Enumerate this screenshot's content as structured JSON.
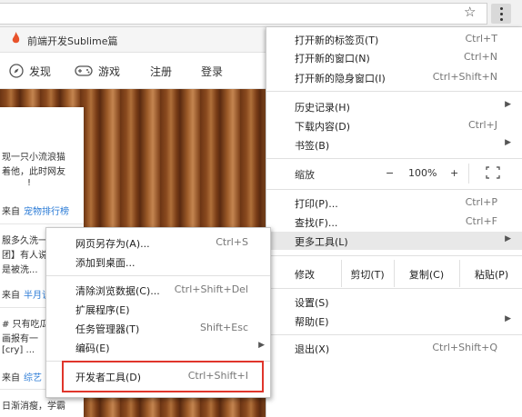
{
  "browser": {
    "star_icon": "star-icon",
    "menu_icon": "vertical-dots-icon"
  },
  "page": {
    "tab_title": "前端开发Sublime篇",
    "nav": {
      "discover": "发现",
      "games": "游戏",
      "register": "注册",
      "login": "登录"
    },
    "card_lines": [
      "现一只小流浪猫",
      "着他，此时网友",
      "!",
      "来自",
      "宠物排行榜",
      "服多久洗一",
      "团】有人说",
      "是被洗...",
      "来自",
      "半月谈",
      "# 只有吃瓜",
      "画报有一",
      "[cry] ...",
      "来自",
      "综艺",
      "日渐消瘦，学霸"
    ]
  },
  "main_menu": {
    "new_tab": {
      "label": "打开新的标签页(T)",
      "shortcut": "Ctrl+T"
    },
    "new_window": {
      "label": "打开新的窗口(N)",
      "shortcut": "Ctrl+N"
    },
    "new_incognito": {
      "label": "打开新的隐身窗口(I)",
      "shortcut": "Ctrl+Shift+N"
    },
    "history": {
      "label": "历史记录(H)"
    },
    "downloads": {
      "label": "下载内容(D)",
      "shortcut": "Ctrl+J"
    },
    "bookmarks": {
      "label": "书签(B)"
    },
    "zoom": {
      "label": "缩放",
      "minus": "−",
      "value": "100%",
      "plus": "+"
    },
    "print": {
      "label": "打印(P)...",
      "shortcut": "Ctrl+P"
    },
    "find": {
      "label": "查找(F)...",
      "shortcut": "Ctrl+F"
    },
    "more_tools": {
      "label": "更多工具(L)"
    },
    "edit": {
      "label": "修改",
      "cut": "剪切(T)",
      "copy": "复制(C)",
      "paste": "粘贴(P)"
    },
    "settings": {
      "label": "设置(S)"
    },
    "help": {
      "label": "帮助(E)"
    },
    "exit": {
      "label": "退出(X)",
      "shortcut": "Ctrl+Shift+Q"
    }
  },
  "sub_menu": {
    "save_as": {
      "label": "网页另存为(A)...",
      "shortcut": "Ctrl+S"
    },
    "add_desktop": {
      "label": "添加到桌面..."
    },
    "clear_data": {
      "label": "清除浏览数据(C)...",
      "shortcut": "Ctrl+Shift+Del"
    },
    "extensions": {
      "label": "扩展程序(E)"
    },
    "task_manager": {
      "label": "任务管理器(T)",
      "shortcut": "Shift+Esc"
    },
    "encoding": {
      "label": "编码(E)"
    },
    "dev_tools": {
      "label": "开发者工具(D)",
      "shortcut": "Ctrl+Shift+I"
    }
  },
  "colors": {
    "highlight_box": "#e0352b",
    "link": "#2b7bd6",
    "tab_flame": "#e8532b"
  }
}
